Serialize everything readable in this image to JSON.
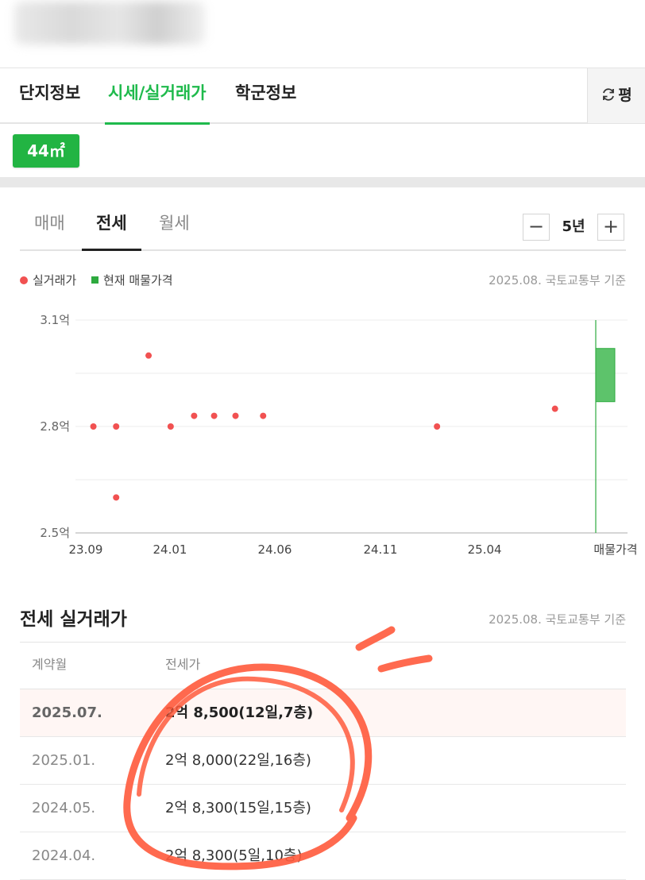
{
  "header": {
    "title_blurred": true
  },
  "main_tabs": [
    {
      "label": "단지정보",
      "active": false
    },
    {
      "label": "시세/실거래가",
      "active": true
    },
    {
      "label": "학군정보",
      "active": false
    }
  ],
  "unit_toggle": {
    "icon": "refresh-icon",
    "label": "평"
  },
  "area_chip": {
    "label": "44㎡"
  },
  "sub_tabs": [
    {
      "label": "매매",
      "active": false
    },
    {
      "label": "전세",
      "active": true
    },
    {
      "label": "월세",
      "active": false
    }
  ],
  "period": {
    "minus_label": "−",
    "value": "5년",
    "plus_label": "+"
  },
  "legend": {
    "transactions_label": "실거래가",
    "listing_label": "현재 매물가격"
  },
  "source_note": "2025.08. 국토교통부 기준",
  "colors": {
    "accent": "#1fba4c",
    "transaction_dot": "#f15151",
    "listing_bar": "#2eaa3f"
  },
  "chart_data": {
    "type": "scatter",
    "y_unit": "억",
    "y_ticks": [
      "3.1억",
      "2.8억",
      "2.5억"
    ],
    "ylim": [
      2.5,
      3.1
    ],
    "x_tick_labels": [
      "23.09",
      "24.01",
      "24.06",
      "24.11",
      "25.04",
      "매물가격"
    ],
    "xlim": [
      "2023-09",
      "2025-09"
    ],
    "grid": true,
    "series": [
      {
        "name": "실거래가",
        "points": [
          {
            "x": "2023-09-12",
            "y": 2.8
          },
          {
            "x": "2023-10-15",
            "y": 2.8
          },
          {
            "x": "2023-10-15",
            "y": 2.6
          },
          {
            "x": "2023-12-01",
            "y": 3.0
          },
          {
            "x": "2024-01-02",
            "y": 2.8
          },
          {
            "x": "2024-02-05",
            "y": 2.83
          },
          {
            "x": "2024-03-05",
            "y": 2.83
          },
          {
            "x": "2024-04-05",
            "y": 2.83
          },
          {
            "x": "2024-05-15",
            "y": 2.83
          },
          {
            "x": "2025-01-22",
            "y": 2.8
          },
          {
            "x": "2025-07-12",
            "y": 2.85
          }
        ]
      },
      {
        "name": "현재 매물가격",
        "range": [
          2.87,
          3.02
        ]
      }
    ]
  },
  "table": {
    "title": "전세 실거래가",
    "source_note": "2025.08. 국토교통부 기준",
    "columns": [
      "계약월",
      "전세가"
    ],
    "rows": [
      {
        "month": "2025.07.",
        "price": "2억 8,500(12일,7층)",
        "highlight": true
      },
      {
        "month": "2025.01.",
        "price": "2억 8,000(22일,16층)",
        "highlight": false
      },
      {
        "month": "2024.05.",
        "price": "2억 8,300(15일,15층)",
        "highlight": false
      },
      {
        "month": "2024.04.",
        "price": "2억 8,300(5일,10층)",
        "highlight": false
      }
    ]
  }
}
